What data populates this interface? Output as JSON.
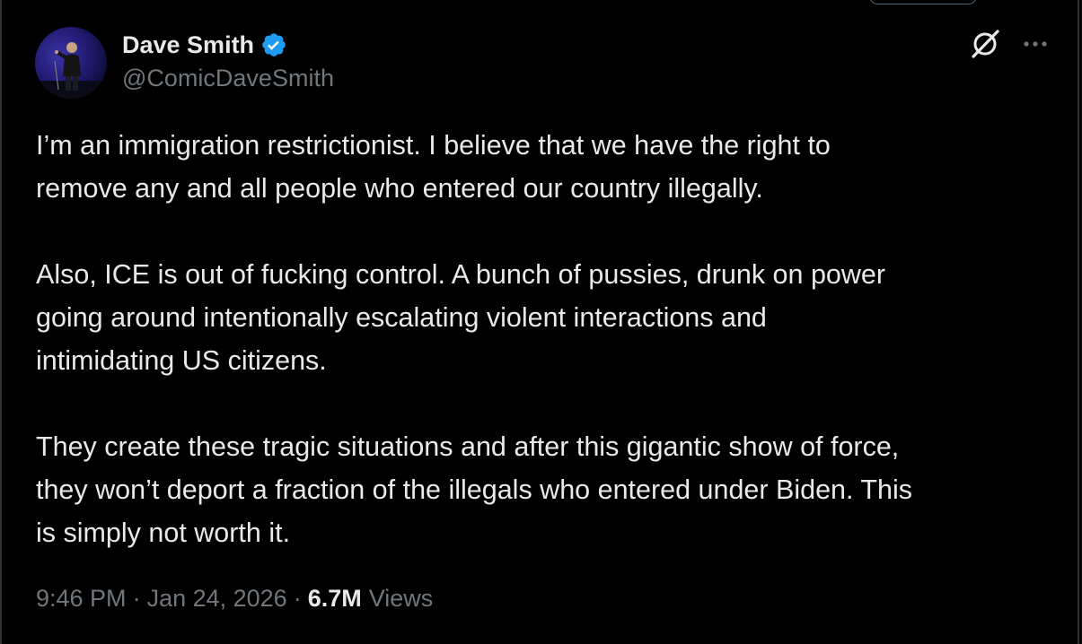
{
  "author": {
    "display_name": "Dave Smith",
    "handle": "@ComicDaveSmith",
    "verified": true,
    "verified_color": "#1d9bf0",
    "avatar": "comedian-on-stage-photo"
  },
  "actions": {
    "grok_icon": "grok-icon",
    "more_icon": "more-horizontal-icon"
  },
  "tweet": {
    "paragraphs": [
      "I’m an immigration restrictionist. I believe that we have the right to\nremove any and all people who entered our country illegally.",
      "Also, ICE is out of fucking control. A bunch of pussies, drunk on power\ngoing around intentionally escalating violent interactions and\nintimidating US citizens.",
      "They create these tragic situations and after this gigantic show of force,\nthey won’t deport a fraction of the illegals who entered under Biden. This\nis simply not worth it."
    ]
  },
  "meta": {
    "time": "9:46 PM",
    "separator": "·",
    "date": "Jan 24, 2026",
    "view_count": "6.7M",
    "views_label": "Views"
  },
  "colors": {
    "background": "#000000",
    "text": "#e7e9ea",
    "muted": "#71767b",
    "border": "#2f3336"
  }
}
